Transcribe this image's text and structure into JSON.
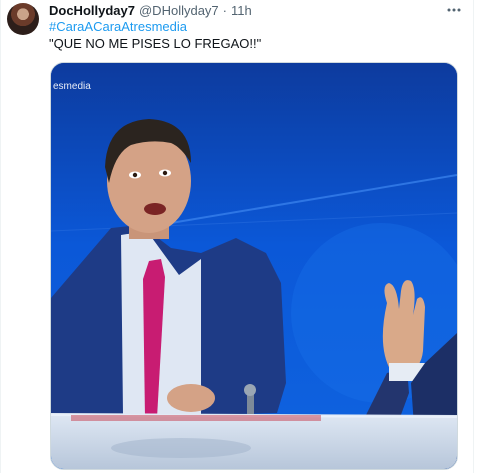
{
  "tweet": {
    "display_name": "DocHollyday7",
    "handle": "@DHollyday7",
    "separator": "·",
    "time": "11h",
    "hashtag": "#CaraACaraAtresmedia",
    "text": "\"QUE NO ME PISES LO FREGAO!!\""
  },
  "media": {
    "watermark": "esmedia"
  },
  "icons": {
    "avatar": "avatar-photo",
    "more": "more-icon"
  }
}
